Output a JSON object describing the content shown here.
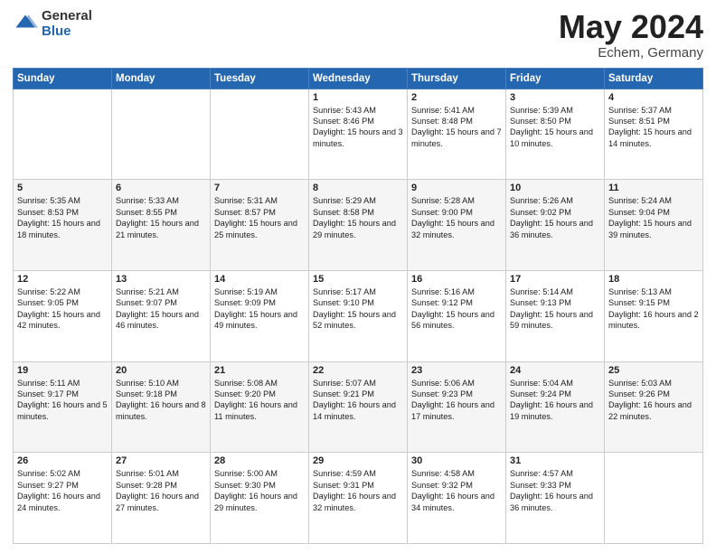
{
  "header": {
    "logo_general": "General",
    "logo_blue": "Blue",
    "title": "May 2024",
    "location": "Echem, Germany"
  },
  "weekdays": [
    "Sunday",
    "Monday",
    "Tuesday",
    "Wednesday",
    "Thursday",
    "Friday",
    "Saturday"
  ],
  "weeks": [
    [
      {
        "day": "",
        "text": ""
      },
      {
        "day": "",
        "text": ""
      },
      {
        "day": "",
        "text": ""
      },
      {
        "day": "1",
        "text": "Sunrise: 5:43 AM\nSunset: 8:46 PM\nDaylight: 15 hours\nand 3 minutes."
      },
      {
        "day": "2",
        "text": "Sunrise: 5:41 AM\nSunset: 8:48 PM\nDaylight: 15 hours\nand 7 minutes."
      },
      {
        "day": "3",
        "text": "Sunrise: 5:39 AM\nSunset: 8:50 PM\nDaylight: 15 hours\nand 10 minutes."
      },
      {
        "day": "4",
        "text": "Sunrise: 5:37 AM\nSunset: 8:51 PM\nDaylight: 15 hours\nand 14 minutes."
      }
    ],
    [
      {
        "day": "5",
        "text": "Sunrise: 5:35 AM\nSunset: 8:53 PM\nDaylight: 15 hours\nand 18 minutes."
      },
      {
        "day": "6",
        "text": "Sunrise: 5:33 AM\nSunset: 8:55 PM\nDaylight: 15 hours\nand 21 minutes."
      },
      {
        "day": "7",
        "text": "Sunrise: 5:31 AM\nSunset: 8:57 PM\nDaylight: 15 hours\nand 25 minutes."
      },
      {
        "day": "8",
        "text": "Sunrise: 5:29 AM\nSunset: 8:58 PM\nDaylight: 15 hours\nand 29 minutes."
      },
      {
        "day": "9",
        "text": "Sunrise: 5:28 AM\nSunset: 9:00 PM\nDaylight: 15 hours\nand 32 minutes."
      },
      {
        "day": "10",
        "text": "Sunrise: 5:26 AM\nSunset: 9:02 PM\nDaylight: 15 hours\nand 36 minutes."
      },
      {
        "day": "11",
        "text": "Sunrise: 5:24 AM\nSunset: 9:04 PM\nDaylight: 15 hours\nand 39 minutes."
      }
    ],
    [
      {
        "day": "12",
        "text": "Sunrise: 5:22 AM\nSunset: 9:05 PM\nDaylight: 15 hours\nand 42 minutes."
      },
      {
        "day": "13",
        "text": "Sunrise: 5:21 AM\nSunset: 9:07 PM\nDaylight: 15 hours\nand 46 minutes."
      },
      {
        "day": "14",
        "text": "Sunrise: 5:19 AM\nSunset: 9:09 PM\nDaylight: 15 hours\nand 49 minutes."
      },
      {
        "day": "15",
        "text": "Sunrise: 5:17 AM\nSunset: 9:10 PM\nDaylight: 15 hours\nand 52 minutes."
      },
      {
        "day": "16",
        "text": "Sunrise: 5:16 AM\nSunset: 9:12 PM\nDaylight: 15 hours\nand 56 minutes."
      },
      {
        "day": "17",
        "text": "Sunrise: 5:14 AM\nSunset: 9:13 PM\nDaylight: 15 hours\nand 59 minutes."
      },
      {
        "day": "18",
        "text": "Sunrise: 5:13 AM\nSunset: 9:15 PM\nDaylight: 16 hours\nand 2 minutes."
      }
    ],
    [
      {
        "day": "19",
        "text": "Sunrise: 5:11 AM\nSunset: 9:17 PM\nDaylight: 16 hours\nand 5 minutes."
      },
      {
        "day": "20",
        "text": "Sunrise: 5:10 AM\nSunset: 9:18 PM\nDaylight: 16 hours\nand 8 minutes."
      },
      {
        "day": "21",
        "text": "Sunrise: 5:08 AM\nSunset: 9:20 PM\nDaylight: 16 hours\nand 11 minutes."
      },
      {
        "day": "22",
        "text": "Sunrise: 5:07 AM\nSunset: 9:21 PM\nDaylight: 16 hours\nand 14 minutes."
      },
      {
        "day": "23",
        "text": "Sunrise: 5:06 AM\nSunset: 9:23 PM\nDaylight: 16 hours\nand 17 minutes."
      },
      {
        "day": "24",
        "text": "Sunrise: 5:04 AM\nSunset: 9:24 PM\nDaylight: 16 hours\nand 19 minutes."
      },
      {
        "day": "25",
        "text": "Sunrise: 5:03 AM\nSunset: 9:26 PM\nDaylight: 16 hours\nand 22 minutes."
      }
    ],
    [
      {
        "day": "26",
        "text": "Sunrise: 5:02 AM\nSunset: 9:27 PM\nDaylight: 16 hours\nand 24 minutes."
      },
      {
        "day": "27",
        "text": "Sunrise: 5:01 AM\nSunset: 9:28 PM\nDaylight: 16 hours\nand 27 minutes."
      },
      {
        "day": "28",
        "text": "Sunrise: 5:00 AM\nSunset: 9:30 PM\nDaylight: 16 hours\nand 29 minutes."
      },
      {
        "day": "29",
        "text": "Sunrise: 4:59 AM\nSunset: 9:31 PM\nDaylight: 16 hours\nand 32 minutes."
      },
      {
        "day": "30",
        "text": "Sunrise: 4:58 AM\nSunset: 9:32 PM\nDaylight: 16 hours\nand 34 minutes."
      },
      {
        "day": "31",
        "text": "Sunrise: 4:57 AM\nSunset: 9:33 PM\nDaylight: 16 hours\nand 36 minutes."
      },
      {
        "day": "",
        "text": ""
      }
    ]
  ]
}
